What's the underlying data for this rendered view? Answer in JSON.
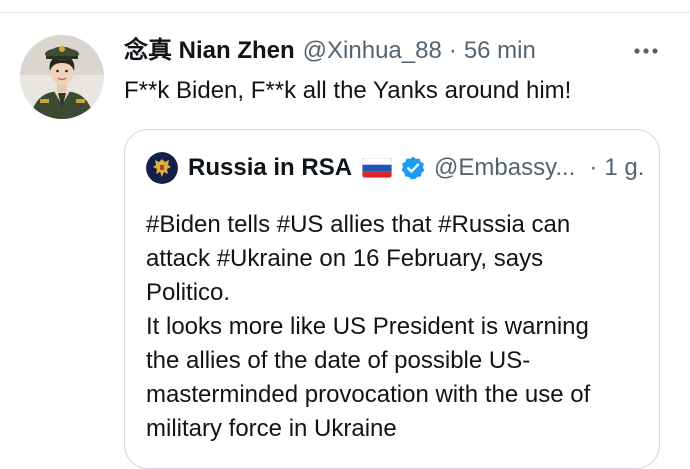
{
  "tweet": {
    "display_name": "念真 Nian Zhen",
    "handle": "@Xinhua_88",
    "separator": "·",
    "time": "56 min",
    "text": "F**k Biden, F**k all the Yanks around him!",
    "avatar_icon": "profile-photo-military-woman",
    "more_icon": "more-options-icon"
  },
  "quote": {
    "display_name": "Russia in RSA",
    "handle": "@Embassy...",
    "separator": "·",
    "time": "1 g.",
    "avatar_icon": "russian-coat-of-arms",
    "flag_icon": "russia-flag-emoji",
    "verified_icon": "verified-badge-icon",
    "text_lines": [
      "#Biden tells #US allies that #Russia can",
      "attack #Ukraine on 16 February, says",
      "Politico.",
      "It looks more like US President is warning",
      "the allies of the date of possible US-",
      "masterminded provocation with the use of",
      "military force in Ukraine"
    ]
  },
  "colors": {
    "text_primary": "#0f1419",
    "text_secondary": "#536471",
    "border": "#cfd9de",
    "verified_blue": "#1d9bf0"
  }
}
